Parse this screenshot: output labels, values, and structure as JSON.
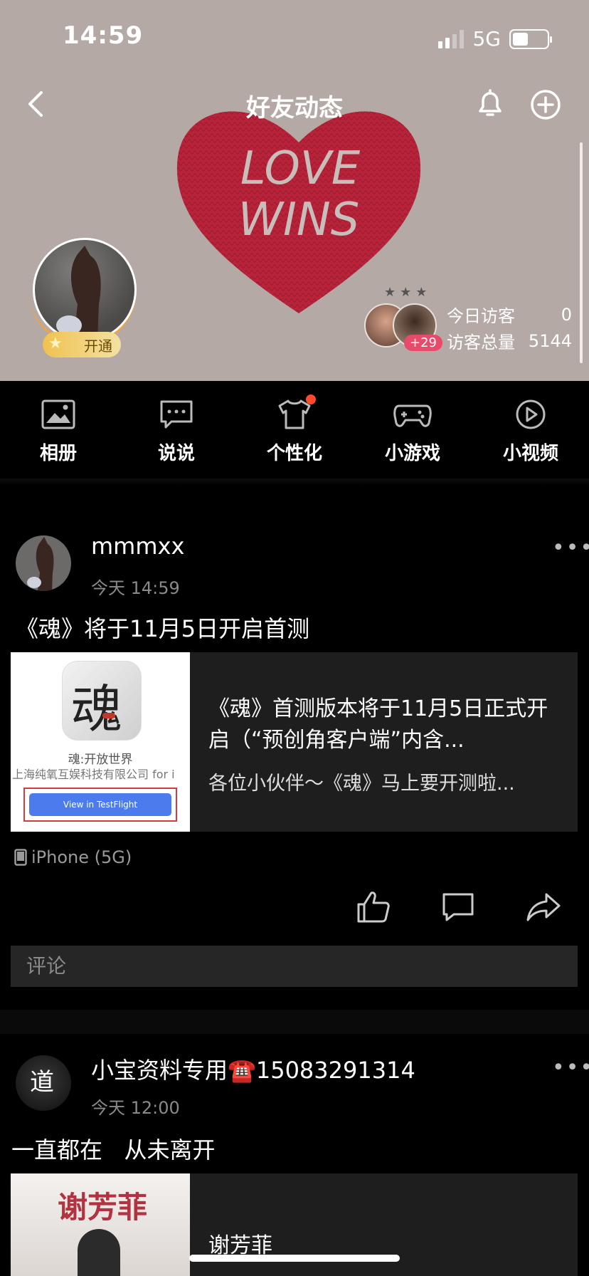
{
  "status_bar": {
    "time": "14:59",
    "network": "5G",
    "battery_percent": 45
  },
  "header": {
    "title": "好友动态",
    "cover_art_text": [
      "LOVE",
      "WINS"
    ],
    "vip_label": "开通",
    "visitors": {
      "today_label": "今日访客",
      "today_value": "0",
      "total_label": "访客总量",
      "total_value": "5144",
      "extra_count": "+29"
    }
  },
  "features": [
    {
      "label": "相册",
      "icon": "album-icon"
    },
    {
      "label": "说说",
      "icon": "talk-icon"
    },
    {
      "label": "个性化",
      "icon": "tshirt-icon",
      "badge": true
    },
    {
      "label": "小游戏",
      "icon": "gamepad-icon"
    },
    {
      "label": "小视频",
      "icon": "video-icon"
    }
  ],
  "posts": [
    {
      "username": "mmmxx",
      "time": "今天 14:59",
      "text": "《魂》将于11月5日开启首测",
      "card": {
        "title": "《魂》首测版本将于11月5日正式开启（“预创角客户端”内含...",
        "desc": "各位小伙伴～《魂》马上要开测啦...",
        "thumb_app_glyph": "魂",
        "thumb_app_name": "魂:开放世界",
        "thumb_company": "上海纯氧互娱科技有限公司 for i",
        "thumb_button": "View in TestFlight"
      },
      "device": "iPhone (5G)",
      "comment_placeholder": "评论"
    },
    {
      "username": "小宝资料专用☎️15083291314",
      "time": "今天 12:00",
      "text": "一直都在   从未离开",
      "avatar_text": "道",
      "card": {
        "title": "谢芳菲",
        "thumb_text": "谢芳菲"
      }
    }
  ],
  "colors": {
    "cover_bg": "#b5a9a6",
    "heart": "#b8233a",
    "badge_red": "#ff4b2b",
    "vip_gold": "#f0c24f",
    "testflight_blue": "#4b7bec"
  }
}
